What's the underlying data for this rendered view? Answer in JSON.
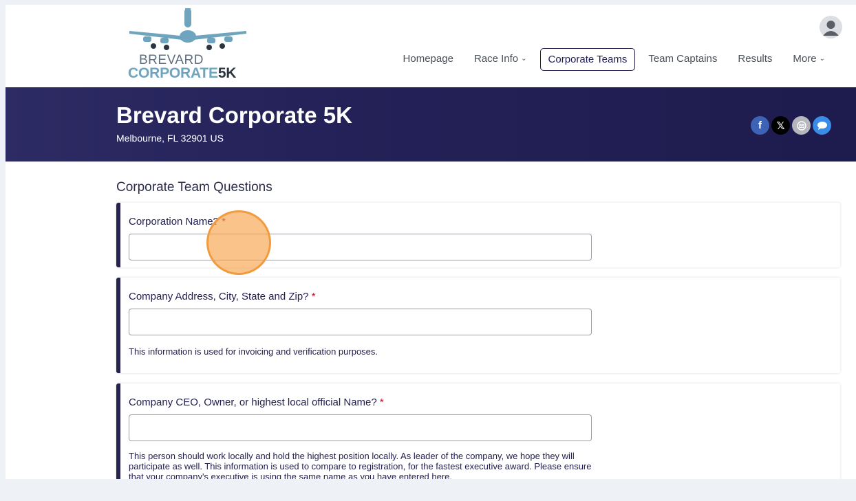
{
  "logo": {
    "line1": "BREVARD",
    "line2_a": "CORPORATE",
    "line2_b": "5K",
    "icon": "airplane-logo-icon"
  },
  "nav": {
    "items": [
      {
        "label": "Homepage",
        "dropdown": false
      },
      {
        "label": "Race Info",
        "dropdown": true
      },
      {
        "label": "Corporate Teams",
        "dropdown": false,
        "active": true
      },
      {
        "label": "Team Captains",
        "dropdown": false
      },
      {
        "label": "Results",
        "dropdown": false
      },
      {
        "label": "More",
        "dropdown": true
      }
    ],
    "avatar_icon": "user-avatar-icon"
  },
  "banner": {
    "title": "Brevard Corporate 5K",
    "location": "Melbourne, FL 32901 US",
    "socials": [
      "facebook-icon",
      "x-icon",
      "email-icon",
      "chat-icon"
    ]
  },
  "form": {
    "section_title": "Corporate Team Questions",
    "questions": [
      {
        "label": "Corporation Name?",
        "required": "*",
        "value": "",
        "help": ""
      },
      {
        "label": "Company Address, City, State and Zip?",
        "required": "*",
        "value": "",
        "help": "This information is used for invoicing and verification purposes."
      },
      {
        "label": "Company CEO, Owner, or highest local official Name?",
        "required": "*",
        "value": "",
        "help": "This person should work locally and hold the highest position locally. As leader of the company, we hope they will participate as well. This information is used to compare to registration, for the fastest executive award. Please ensure that your company's executive is using the same name as you have entered here."
      }
    ]
  },
  "colors": {
    "brand_navy": "#1f1d4d",
    "required_red": "#c3112a",
    "logo_blue": "#6ea4bd",
    "cursor_orange": "#f19a3e"
  }
}
